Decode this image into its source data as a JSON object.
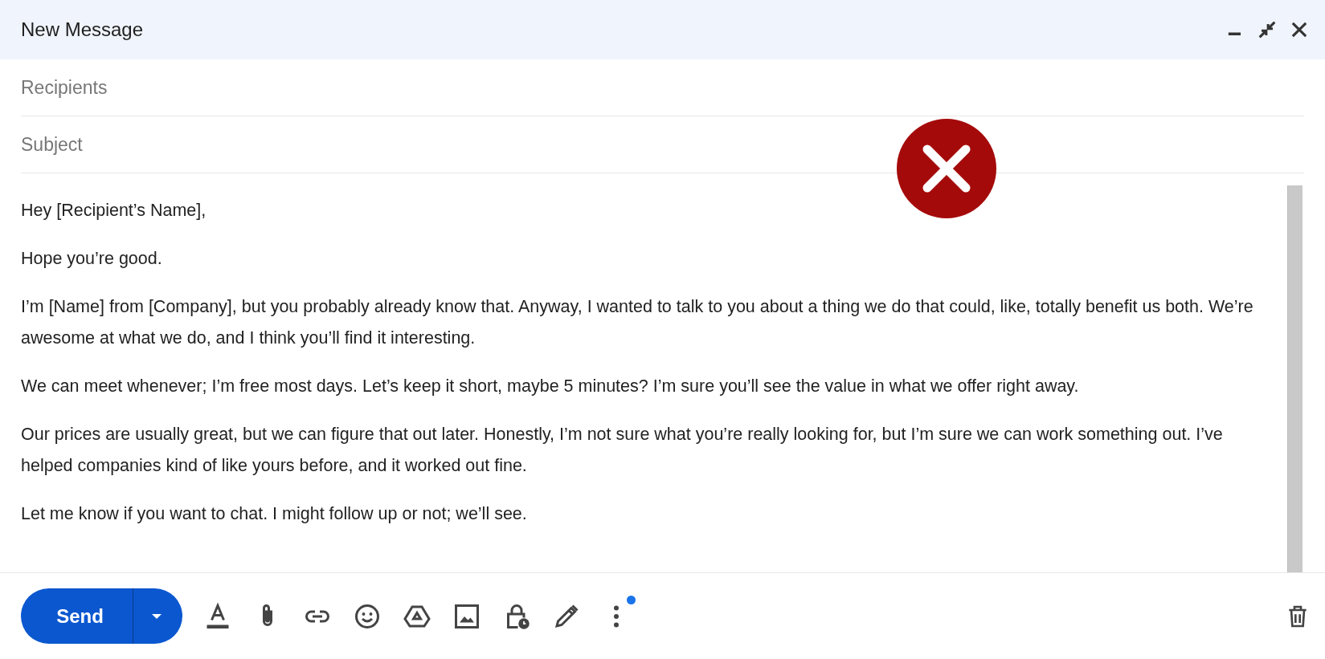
{
  "window": {
    "title": "New Message"
  },
  "recipients": {
    "placeholder": "Recipients"
  },
  "subject": {
    "placeholder": "Subject"
  },
  "body": [
    "Hey [Recipient’s Name],",
    "Hope you’re good.",
    "I’m [Name] from [Company], but you probably already know that. Anyway, I wanted to talk to you about a thing we do that could, like, totally benefit us both. We’re awesome at what we do, and I think you’ll find it interesting.",
    "We can meet whenever; I’m free most days. Let’s keep it short, maybe 5 minutes? I’m sure you’ll see the value in what we offer right away.",
    "Our prices are usually great, but we can figure that out later. Honestly, I’m not sure what you’re really looking for, but I’m sure we can work something out. I’ve helped companies kind of like yours before, and it worked out fine.",
    "Let me know if you want to chat. I might follow up or not; we’ll see."
  ],
  "send_button": {
    "label": "Send"
  },
  "more_options": {
    "notification": true
  },
  "overlay": {
    "kind": "cross"
  }
}
